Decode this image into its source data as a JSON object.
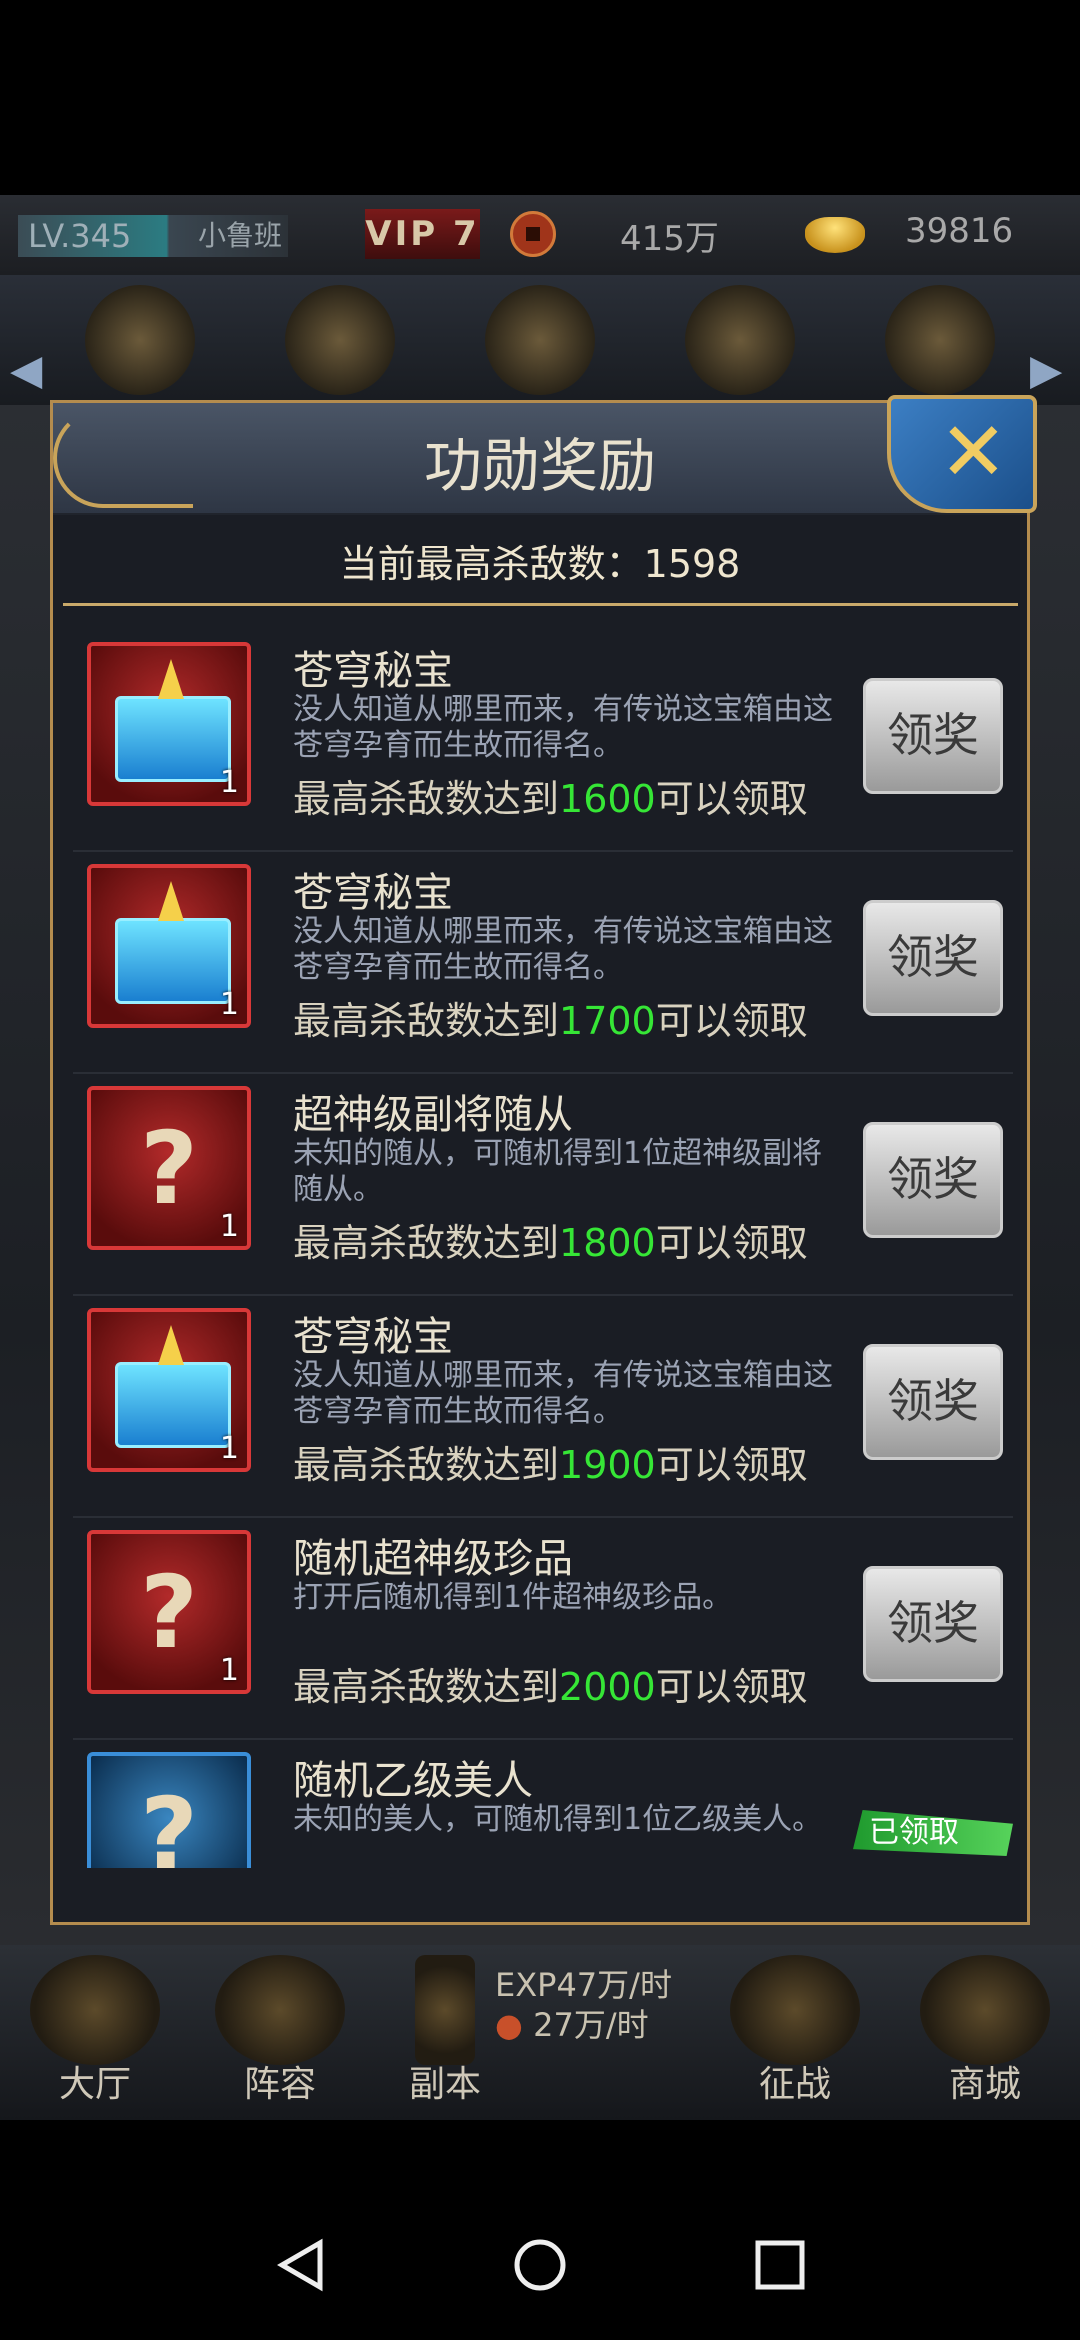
{
  "topbar": {
    "level": "LV.345",
    "player_name": "小鲁班",
    "vip": "VIP 7",
    "coin_value": "415万",
    "gold_value": "39816"
  },
  "panel": {
    "title": "功勋奖励",
    "max_kill_label": "当前最高杀敌数：1598",
    "close_icon": "close-x-icon"
  },
  "rewards": [
    {
      "name": "苍穹秘宝",
      "desc": "没人知道从哪里而来，有传说这宝箱由这苍穹孕育而生故而得名。",
      "cond_prefix": "最高杀敌数达到",
      "target": "1600",
      "cond_suffix": "可以领取",
      "count": "1",
      "icon": "treasure-chest-icon",
      "button": "领奖"
    },
    {
      "name": "苍穹秘宝",
      "desc": "没人知道从哪里而来，有传说这宝箱由这苍穹孕育而生故而得名。",
      "cond_prefix": "最高杀敌数达到",
      "target": "1700",
      "cond_suffix": "可以领取",
      "count": "1",
      "icon": "treasure-chest-icon",
      "button": "领奖"
    },
    {
      "name": "超神级副将随从",
      "desc": "未知的随从，可随机得到1位超神级副将随从。",
      "cond_prefix": "最高杀敌数达到",
      "target": "1800",
      "cond_suffix": "可以领取",
      "count": "1",
      "icon": "mystery-follower-icon",
      "button": "领奖"
    },
    {
      "name": "苍穹秘宝",
      "desc": "没人知道从哪里而来，有传说这宝箱由这苍穹孕育而生故而得名。",
      "cond_prefix": "最高杀敌数达到",
      "target": "1900",
      "cond_suffix": "可以领取",
      "count": "1",
      "icon": "treasure-chest-icon",
      "button": "领奖"
    },
    {
      "name": "随机超神级珍品",
      "desc": "打开后随机得到1件超神级珍品。",
      "cond_prefix": "最高杀敌数达到",
      "target": "2000",
      "cond_suffix": "可以领取",
      "count": "1",
      "icon": "mystery-item-icon",
      "button": "领奖"
    },
    {
      "name": "随机乙级美人",
      "desc": "未知的美人，可随机得到1位乙级美人。",
      "count": "",
      "icon": "mystery-beauty-icon",
      "claimed_label": "已领取"
    }
  ],
  "bottom_nav": {
    "items": [
      "大厅",
      "阵容",
      "副本",
      "征战",
      "商城"
    ],
    "exp_rate": "EXP47万/时",
    "coin_rate": "27万/时"
  },
  "colors": {
    "accent_gold": "#b48c4e",
    "target_green": "#36e636",
    "icon_red": "#d83838",
    "icon_blue": "#3a8ed8"
  }
}
